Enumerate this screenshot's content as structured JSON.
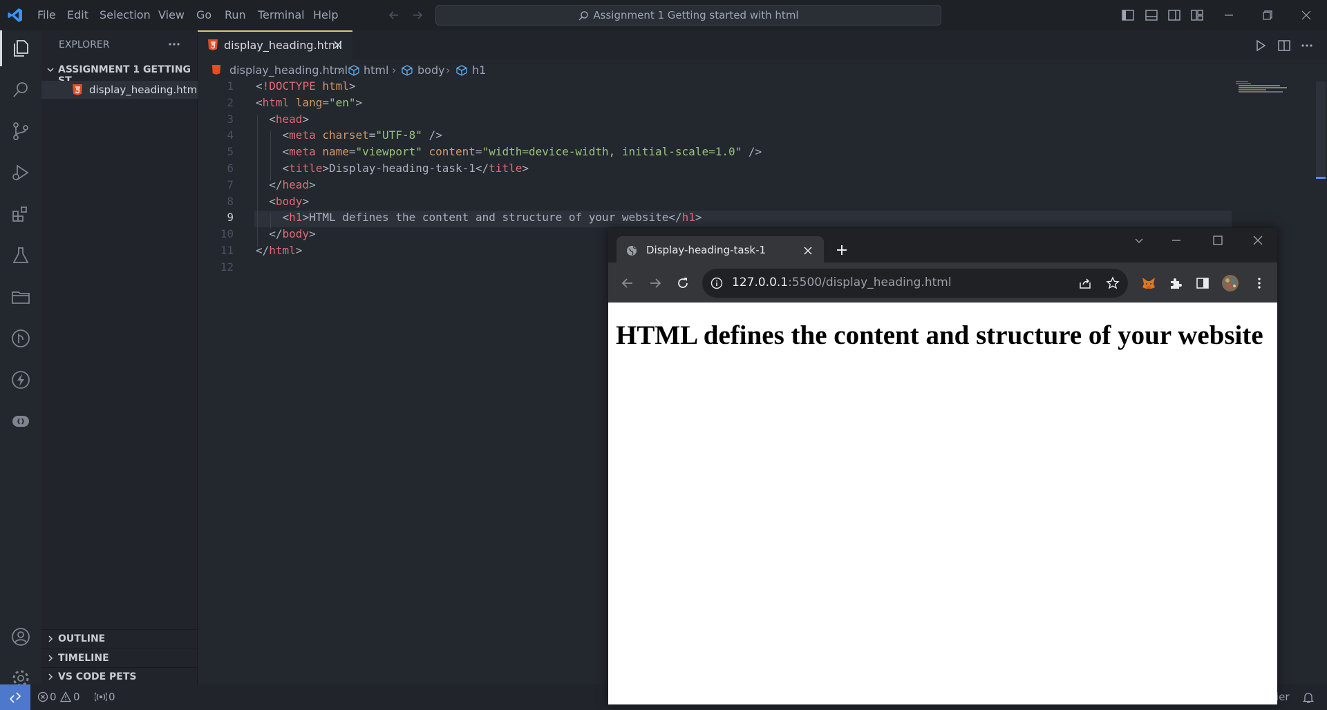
{
  "titlebar": {
    "menu": [
      "File",
      "Edit",
      "Selection",
      "View",
      "Go",
      "Run",
      "Terminal",
      "Help"
    ],
    "command_center": "Assignment 1 Getting started with html"
  },
  "sidebar": {
    "title": "EXPLORER",
    "folder": "ASSIGNMENT 1 GETTING ST...",
    "file": "display_heading.html",
    "sections": [
      "OUTLINE",
      "TIMELINE",
      "VS CODE PETS"
    ]
  },
  "editor": {
    "tab_label": "display_heading.html",
    "breadcrumb": [
      "display_heading.html",
      "html",
      "body",
      "h1"
    ],
    "current_line": 9,
    "lines": [
      "<!DOCTYPE html>",
      "<html lang=\"en\">",
      "  <head>",
      "    <meta charset=\"UTF-8\" />",
      "    <meta name=\"viewport\" content=\"width=device-width, initial-scale=1.0\" />",
      "    <title>Display-heading-task-1</title>",
      "  </head>",
      "  <body>",
      "    <h1>HTML defines the content and structure of your website</h1>",
      "  </body>",
      "</html>",
      ""
    ]
  },
  "statusbar": {
    "errors": "0",
    "warnings": "0",
    "ports": "0",
    "right_text": "ier"
  },
  "browser": {
    "tab_title": "Display-heading-task-1",
    "url_host": "127.0.0.1",
    "url_rest": ":5500/display_heading.html",
    "heading": "HTML defines the content and structure of your website"
  }
}
